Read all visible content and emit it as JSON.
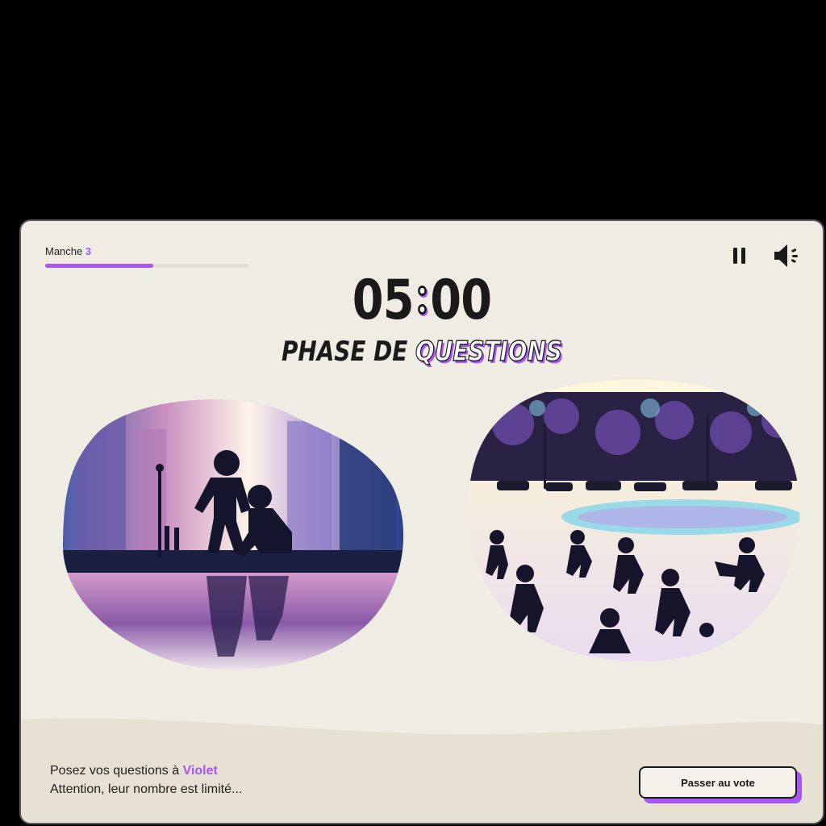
{
  "round": {
    "label": "Manche",
    "number": "3",
    "progress_fraction": 0.53
  },
  "controls": {
    "pause_icon": "pause-icon",
    "sound_icon": "speaker-icon"
  },
  "timer": {
    "minutes": "05",
    "seconds": "00"
  },
  "phase": {
    "prefix": "PHASE DE",
    "highlight": "QUESTIONS"
  },
  "images": {
    "left_scene": "children-silhouettes-puddle",
    "right_scene": "children-playing-park"
  },
  "prompt": {
    "line1_prefix": "Posez vos questions à",
    "player_name": "Violet",
    "line2": "Attention, leur nombre est limité..."
  },
  "actions": {
    "vote_label": "Passer au vote"
  },
  "colors": {
    "accent": "#a855f7",
    "background": "#efece3",
    "ink": "#1a1a1a"
  }
}
